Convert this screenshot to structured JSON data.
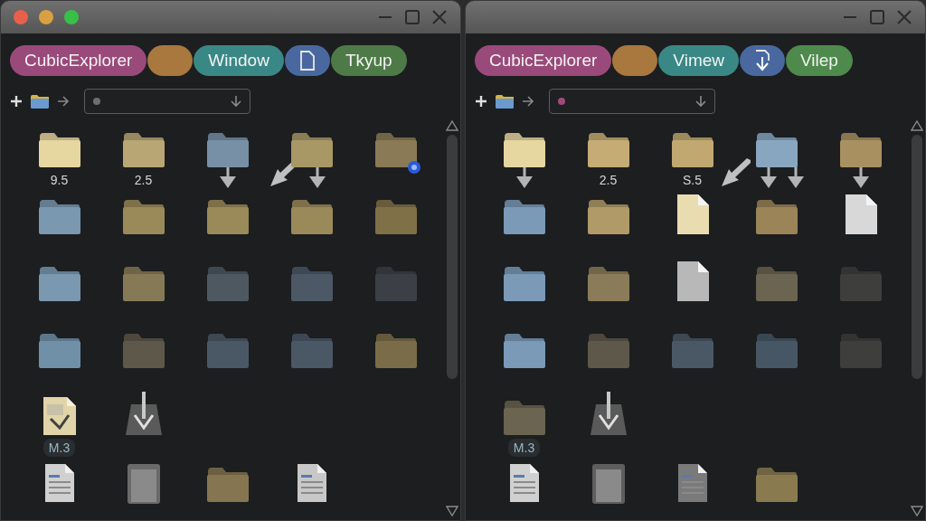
{
  "windows": [
    {
      "traffic_lights": true,
      "tabs": [
        {
          "kind": "text",
          "label": "CubicExplorer",
          "color": "#9a4a7a"
        },
        {
          "kind": "blank",
          "color": "#a8783e"
        },
        {
          "kind": "text",
          "label": "Window",
          "color": "#3a8886"
        },
        {
          "kind": "doc",
          "color": "#4a68a0"
        },
        {
          "kind": "text",
          "label": "Tkyup",
          "color": "#4e7a48"
        }
      ],
      "address_field": {
        "color": "#6e6e6e"
      },
      "rows": [
        [
          {
            "kind": "folder",
            "color": "#e6d6a0",
            "label": "9.5",
            "pinned": false
          },
          {
            "kind": "folder",
            "color": "#b8a674",
            "label": "2.5",
            "pinned": false
          },
          {
            "kind": "folder",
            "color": "#7890a6",
            "arrows": [
              {
                "kind": "down"
              }
            ],
            "pinned": false
          },
          {
            "kind": "folder",
            "color": "#a89866",
            "arrows": [
              {
                "kind": "down-left"
              },
              {
                "kind": "down"
              }
            ],
            "pinned": false
          },
          {
            "kind": "folder",
            "color": "#8a7a56",
            "pinned": true
          }
        ],
        [
          {
            "kind": "folder",
            "color": "#7a98b0",
            "pinned": false
          },
          {
            "kind": "folder",
            "color": "#9a8a5a",
            "pinned": false
          },
          {
            "kind": "folder",
            "color": "#9a8a5a",
            "pinned": false
          },
          {
            "kind": "folder",
            "color": "#9a8a5a",
            "pinned": false
          },
          {
            "kind": "folder",
            "color": "#807048",
            "pinned": false
          }
        ],
        [
          {
            "kind": "folder",
            "color": "#7a98b0",
            "pinned": false
          },
          {
            "kind": "folder",
            "color": "#867a56",
            "pinned": false
          },
          {
            "kind": "folder",
            "color": "#4e5860",
            "pinned": false
          },
          {
            "kind": "folder",
            "color": "#4c5866",
            "pinned": false
          },
          {
            "kind": "folder",
            "color": "#3c4046",
            "pinned": false
          }
        ],
        [
          {
            "kind": "folder",
            "color": "#7090a8",
            "pinned": false
          },
          {
            "kind": "folder",
            "color": "#5e584a",
            "pinned": false
          },
          {
            "kind": "folder",
            "color": "#4a5866",
            "pinned": false
          },
          {
            "kind": "folder",
            "color": "#4a5866",
            "pinned": false
          },
          {
            "kind": "folder",
            "color": "#7a6c48",
            "pinned": false
          }
        ],
        [
          {
            "kind": "sketch",
            "color": "#e0d4a8",
            "label": "M.3",
            "pinned": false
          },
          {
            "kind": "download",
            "color": "#5a5a5a",
            "pinned": false
          }
        ],
        [
          {
            "kind": "doc",
            "color": "#d0d0d0",
            "pinned": false
          },
          {
            "kind": "preview",
            "color": "#6a6a6a",
            "pinned": false
          },
          {
            "kind": "folder",
            "color": "#857550",
            "pinned": false
          },
          {
            "kind": "doc",
            "color": "#c8c8c8",
            "pinned": false
          }
        ]
      ]
    },
    {
      "traffic_lights": false,
      "tabs": [
        {
          "kind": "text",
          "label": "CubicExplorer",
          "color": "#9a4a7a"
        },
        {
          "kind": "blank",
          "color": "#a8783e"
        },
        {
          "kind": "text",
          "label": "Vimew",
          "color": "#3a8886"
        },
        {
          "kind": "download",
          "color": "#4a68a0"
        },
        {
          "kind": "text",
          "label": "Vilep",
          "color": "#4e8a4c"
        }
      ],
      "address_field": {
        "color": "#a04a78"
      },
      "rows": [
        [
          {
            "kind": "folder",
            "color": "#e6d6a0",
            "arrows": [
              {
                "kind": "down"
              }
            ],
            "pinned": false
          },
          {
            "kind": "folder",
            "color": "#c4ac74",
            "label": "2.5",
            "pinned": false
          },
          {
            "kind": "folder",
            "color": "#c0a870",
            "label": "S.5",
            "pinned": false
          },
          {
            "kind": "folder",
            "color": "#88a6c0",
            "arrows": [
              {
                "kind": "down-left"
              },
              {
                "kind": "down"
              },
              {
                "kind": "down"
              }
            ],
            "pinned": false
          },
          {
            "kind": "folder",
            "color": "#a89060",
            "arrows": [
              {
                "kind": "down"
              }
            ],
            "pinned": false
          }
        ],
        [
          {
            "kind": "folder",
            "color": "#7a9ab8",
            "pinned": false
          },
          {
            "kind": "folder",
            "color": "#b09a68",
            "pinned": false
          },
          {
            "kind": "file",
            "color": "#e8dcb0",
            "pinned": false
          },
          {
            "kind": "folder",
            "color": "#9a8458",
            "pinned": false
          },
          {
            "kind": "file",
            "color": "#d8d8d8",
            "pinned": false
          }
        ],
        [
          {
            "kind": "folder",
            "color": "#7a9ab8",
            "pinned": false
          },
          {
            "kind": "folder",
            "color": "#8a7c58",
            "pinned": false
          },
          {
            "kind": "file",
            "color": "#b8b8b8",
            "pinned": false
          },
          {
            "kind": "folder",
            "color": "#6a6450",
            "pinned": false
          },
          {
            "kind": "folder",
            "color": "#3e3e3c",
            "pinned": false
          }
        ],
        [
          {
            "kind": "folder",
            "color": "#7a9ab8",
            "pinned": false
          },
          {
            "kind": "folder",
            "color": "#5e584a",
            "pinned": false
          },
          {
            "kind": "folder",
            "color": "#4a5866",
            "pinned": false
          },
          {
            "kind": "folder",
            "color": "#465664",
            "pinned": false
          },
          {
            "kind": "folder",
            "color": "#3e3e3c",
            "pinned": false
          }
        ],
        [
          {
            "kind": "folder",
            "color": "#6a6450",
            "label": "M.3",
            "pinned": false
          },
          {
            "kind": "download",
            "color": "#5a5a5a",
            "pinned": false
          }
        ],
        [
          {
            "kind": "doc",
            "color": "#d0d0d0",
            "pinned": false
          },
          {
            "kind": "preview",
            "color": "#5e5e5e",
            "pinned": false
          },
          {
            "kind": "doc",
            "color": "#7a7a7a",
            "pinned": false
          },
          {
            "kind": "folder",
            "color": "#8a7a50",
            "pinned": false
          }
        ]
      ]
    }
  ]
}
